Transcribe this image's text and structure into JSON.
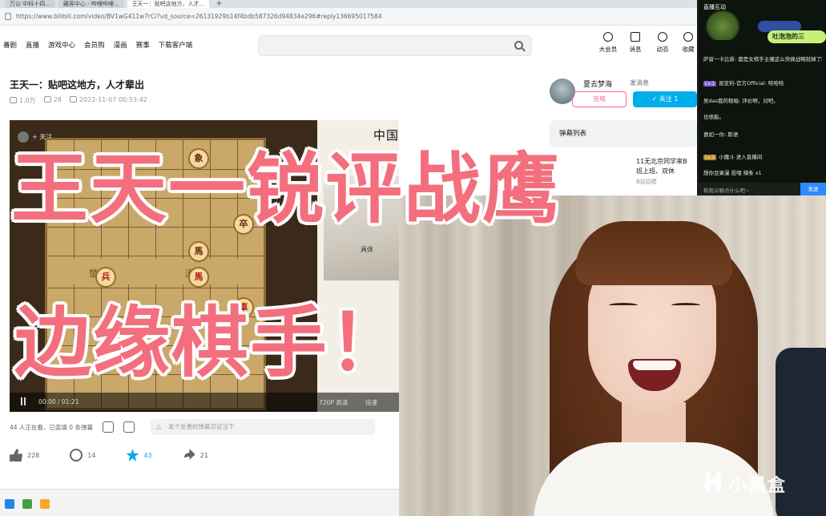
{
  "browser": {
    "tabs": [
      {
        "label": "万公 中科十四..."
      },
      {
        "label": "藏客中心 - 哔哩哔哩..."
      },
      {
        "label": "王天一：贴吧这地方，人才..."
      }
    ],
    "url": "https://www.bilibili.com/video/BV1wG411w7rC/?vd_source=26131929b14f4bdb587326d94834e296#reply136695017584"
  },
  "site_nav": {
    "links": [
      "番剧",
      "直播",
      "游戏中心",
      "会员购",
      "漫画",
      "赛事",
      "下载客户端"
    ],
    "right_items": [
      {
        "label": "大会员",
        "icon": "vip-icon"
      },
      {
        "label": "消息",
        "icon": "message-icon"
      },
      {
        "label": "动态",
        "icon": "dynamic-icon"
      },
      {
        "label": "收藏",
        "icon": "favorite-icon"
      }
    ]
  },
  "video": {
    "title": "王天一：贴吧这地方，人才辈出",
    "views": "1.0万",
    "danmaku_count": "28",
    "publish_time": "2022-11-07 00:53:42",
    "player_follow": "+ 关注",
    "side_title": "中国象棋第一人",
    "side_author": "具体",
    "time": "00:00 / 01:21",
    "quality": "720P 高清",
    "speed": "倍速",
    "river_left": "楚 河",
    "river_right": "漢 界"
  },
  "pieces": [
    {
      "label": "象",
      "side": "black"
    },
    {
      "label": "卒",
      "side": "black"
    },
    {
      "label": "馬",
      "side": "black"
    },
    {
      "label": "馬",
      "side": "red"
    },
    {
      "label": "兵",
      "side": "red"
    },
    {
      "label": "車",
      "side": "red"
    }
  ],
  "danmaku_bar": {
    "status": "44 人正在看，已装填 0 条弹幕",
    "placeholder": "发个友善的弹幕见证当下"
  },
  "actions": {
    "like": "228",
    "coin": "14",
    "favorite": "43",
    "share": "21"
  },
  "uploader": {
    "name": "夏去梦海",
    "message": "发消息",
    "charge": "充电",
    "follow": "✓ 关注 1"
  },
  "sidebar": {
    "danmaku_list": "弹幕列表",
    "rec_line1": "11无北京同学来B",
    "rec_line2": "班上班、双休",
    "rec_tag": "B站招聘"
  },
  "live_chat": {
    "title": "直播互动",
    "bubble": "吐泡泡的三",
    "lines": [
      {
        "text": "萨留一卡比新: 都是女棋手主播这么快换战略就掉了吗",
        "level": ""
      },
      {
        "text": "屈亚利-官方Official: 哈哈哈",
        "level": "Lv.1"
      },
      {
        "text": "吴das我的租暗: 评价啊，对吧。",
        "level": ""
      },
      {
        "text": "也很能。",
        "level": ""
      },
      {
        "text": "喜如一你: 斯语",
        "level": ""
      },
      {
        "text": "小魔斗 进入直播间",
        "level": "Lv.2"
      },
      {
        "text": "想你豆果漫 投喂 辣条 x1",
        "level": ""
      }
    ],
    "input_placeholder": "和观众聊点什么吧~",
    "send": "发送"
  },
  "captions": {
    "line1": "王天一锐评战鹰",
    "line2": "边缘棋手！",
    "color": "#f36f7e"
  },
  "watermark": {
    "text": "小黑盒"
  }
}
